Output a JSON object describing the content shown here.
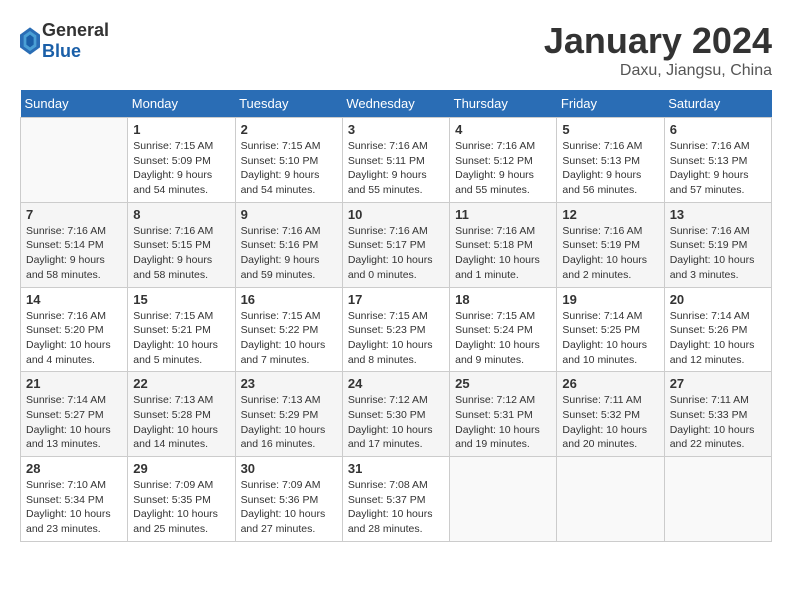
{
  "header": {
    "logo_general": "General",
    "logo_blue": "Blue",
    "month_title": "January 2024",
    "location": "Daxu, Jiangsu, China"
  },
  "weekdays": [
    "Sunday",
    "Monday",
    "Tuesday",
    "Wednesday",
    "Thursday",
    "Friday",
    "Saturday"
  ],
  "weeks": [
    [
      {
        "day": "",
        "sunrise": "",
        "sunset": "",
        "daylight": ""
      },
      {
        "day": "1",
        "sunrise": "Sunrise: 7:15 AM",
        "sunset": "Sunset: 5:09 PM",
        "daylight": "Daylight: 9 hours and 54 minutes."
      },
      {
        "day": "2",
        "sunrise": "Sunrise: 7:15 AM",
        "sunset": "Sunset: 5:10 PM",
        "daylight": "Daylight: 9 hours and 54 minutes."
      },
      {
        "day": "3",
        "sunrise": "Sunrise: 7:16 AM",
        "sunset": "Sunset: 5:11 PM",
        "daylight": "Daylight: 9 hours and 55 minutes."
      },
      {
        "day": "4",
        "sunrise": "Sunrise: 7:16 AM",
        "sunset": "Sunset: 5:12 PM",
        "daylight": "Daylight: 9 hours and 55 minutes."
      },
      {
        "day": "5",
        "sunrise": "Sunrise: 7:16 AM",
        "sunset": "Sunset: 5:13 PM",
        "daylight": "Daylight: 9 hours and 56 minutes."
      },
      {
        "day": "6",
        "sunrise": "Sunrise: 7:16 AM",
        "sunset": "Sunset: 5:13 PM",
        "daylight": "Daylight: 9 hours and 57 minutes."
      }
    ],
    [
      {
        "day": "7",
        "sunrise": "Sunrise: 7:16 AM",
        "sunset": "Sunset: 5:14 PM",
        "daylight": "Daylight: 9 hours and 58 minutes."
      },
      {
        "day": "8",
        "sunrise": "Sunrise: 7:16 AM",
        "sunset": "Sunset: 5:15 PM",
        "daylight": "Daylight: 9 hours and 58 minutes."
      },
      {
        "day": "9",
        "sunrise": "Sunrise: 7:16 AM",
        "sunset": "Sunset: 5:16 PM",
        "daylight": "Daylight: 9 hours and 59 minutes."
      },
      {
        "day": "10",
        "sunrise": "Sunrise: 7:16 AM",
        "sunset": "Sunset: 5:17 PM",
        "daylight": "Daylight: 10 hours and 0 minutes."
      },
      {
        "day": "11",
        "sunrise": "Sunrise: 7:16 AM",
        "sunset": "Sunset: 5:18 PM",
        "daylight": "Daylight: 10 hours and 1 minute."
      },
      {
        "day": "12",
        "sunrise": "Sunrise: 7:16 AM",
        "sunset": "Sunset: 5:19 PM",
        "daylight": "Daylight: 10 hours and 2 minutes."
      },
      {
        "day": "13",
        "sunrise": "Sunrise: 7:16 AM",
        "sunset": "Sunset: 5:19 PM",
        "daylight": "Daylight: 10 hours and 3 minutes."
      }
    ],
    [
      {
        "day": "14",
        "sunrise": "Sunrise: 7:16 AM",
        "sunset": "Sunset: 5:20 PM",
        "daylight": "Daylight: 10 hours and 4 minutes."
      },
      {
        "day": "15",
        "sunrise": "Sunrise: 7:15 AM",
        "sunset": "Sunset: 5:21 PM",
        "daylight": "Daylight: 10 hours and 5 minutes."
      },
      {
        "day": "16",
        "sunrise": "Sunrise: 7:15 AM",
        "sunset": "Sunset: 5:22 PM",
        "daylight": "Daylight: 10 hours and 7 minutes."
      },
      {
        "day": "17",
        "sunrise": "Sunrise: 7:15 AM",
        "sunset": "Sunset: 5:23 PM",
        "daylight": "Daylight: 10 hours and 8 minutes."
      },
      {
        "day": "18",
        "sunrise": "Sunrise: 7:15 AM",
        "sunset": "Sunset: 5:24 PM",
        "daylight": "Daylight: 10 hours and 9 minutes."
      },
      {
        "day": "19",
        "sunrise": "Sunrise: 7:14 AM",
        "sunset": "Sunset: 5:25 PM",
        "daylight": "Daylight: 10 hours and 10 minutes."
      },
      {
        "day": "20",
        "sunrise": "Sunrise: 7:14 AM",
        "sunset": "Sunset: 5:26 PM",
        "daylight": "Daylight: 10 hours and 12 minutes."
      }
    ],
    [
      {
        "day": "21",
        "sunrise": "Sunrise: 7:14 AM",
        "sunset": "Sunset: 5:27 PM",
        "daylight": "Daylight: 10 hours and 13 minutes."
      },
      {
        "day": "22",
        "sunrise": "Sunrise: 7:13 AM",
        "sunset": "Sunset: 5:28 PM",
        "daylight": "Daylight: 10 hours and 14 minutes."
      },
      {
        "day": "23",
        "sunrise": "Sunrise: 7:13 AM",
        "sunset": "Sunset: 5:29 PM",
        "daylight": "Daylight: 10 hours and 16 minutes."
      },
      {
        "day": "24",
        "sunrise": "Sunrise: 7:12 AM",
        "sunset": "Sunset: 5:30 PM",
        "daylight": "Daylight: 10 hours and 17 minutes."
      },
      {
        "day": "25",
        "sunrise": "Sunrise: 7:12 AM",
        "sunset": "Sunset: 5:31 PM",
        "daylight": "Daylight: 10 hours and 19 minutes."
      },
      {
        "day": "26",
        "sunrise": "Sunrise: 7:11 AM",
        "sunset": "Sunset: 5:32 PM",
        "daylight": "Daylight: 10 hours and 20 minutes."
      },
      {
        "day": "27",
        "sunrise": "Sunrise: 7:11 AM",
        "sunset": "Sunset: 5:33 PM",
        "daylight": "Daylight: 10 hours and 22 minutes."
      }
    ],
    [
      {
        "day": "28",
        "sunrise": "Sunrise: 7:10 AM",
        "sunset": "Sunset: 5:34 PM",
        "daylight": "Daylight: 10 hours and 23 minutes."
      },
      {
        "day": "29",
        "sunrise": "Sunrise: 7:09 AM",
        "sunset": "Sunset: 5:35 PM",
        "daylight": "Daylight: 10 hours and 25 minutes."
      },
      {
        "day": "30",
        "sunrise": "Sunrise: 7:09 AM",
        "sunset": "Sunset: 5:36 PM",
        "daylight": "Daylight: 10 hours and 27 minutes."
      },
      {
        "day": "31",
        "sunrise": "Sunrise: 7:08 AM",
        "sunset": "Sunset: 5:37 PM",
        "daylight": "Daylight: 10 hours and 28 minutes."
      },
      {
        "day": "",
        "sunrise": "",
        "sunset": "",
        "daylight": ""
      },
      {
        "day": "",
        "sunrise": "",
        "sunset": "",
        "daylight": ""
      },
      {
        "day": "",
        "sunrise": "",
        "sunset": "",
        "daylight": ""
      }
    ]
  ]
}
